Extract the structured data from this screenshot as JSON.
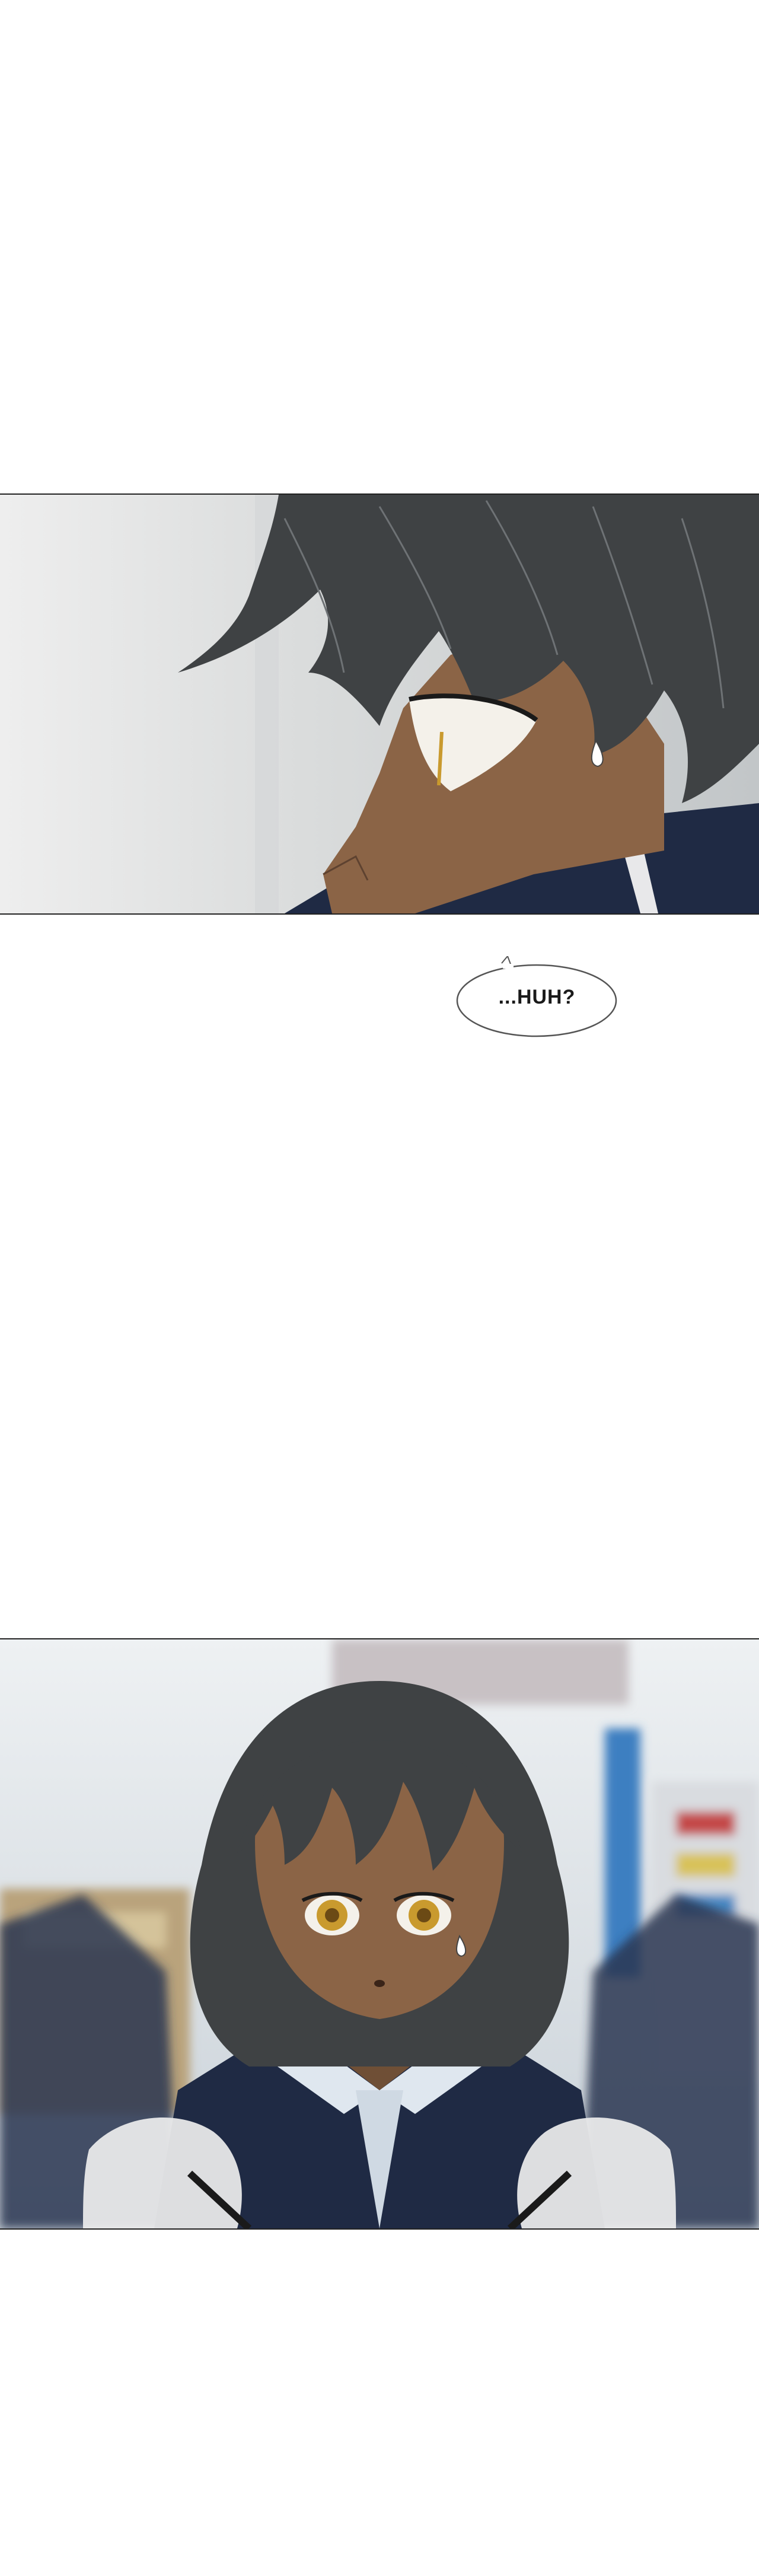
{
  "dialogue": {
    "bubble1": "...HUH?"
  },
  "colors": {
    "page_background": "#ffffff",
    "panel_border": "#222222",
    "hair": "#3f4244",
    "skin": "#8b6446",
    "uniform": "#1f2a44",
    "eye": "#c99a2e"
  },
  "icons": {
    "panel1": "closeup-profile-closed-eye",
    "panel2": "girl-portrait-surprised"
  }
}
